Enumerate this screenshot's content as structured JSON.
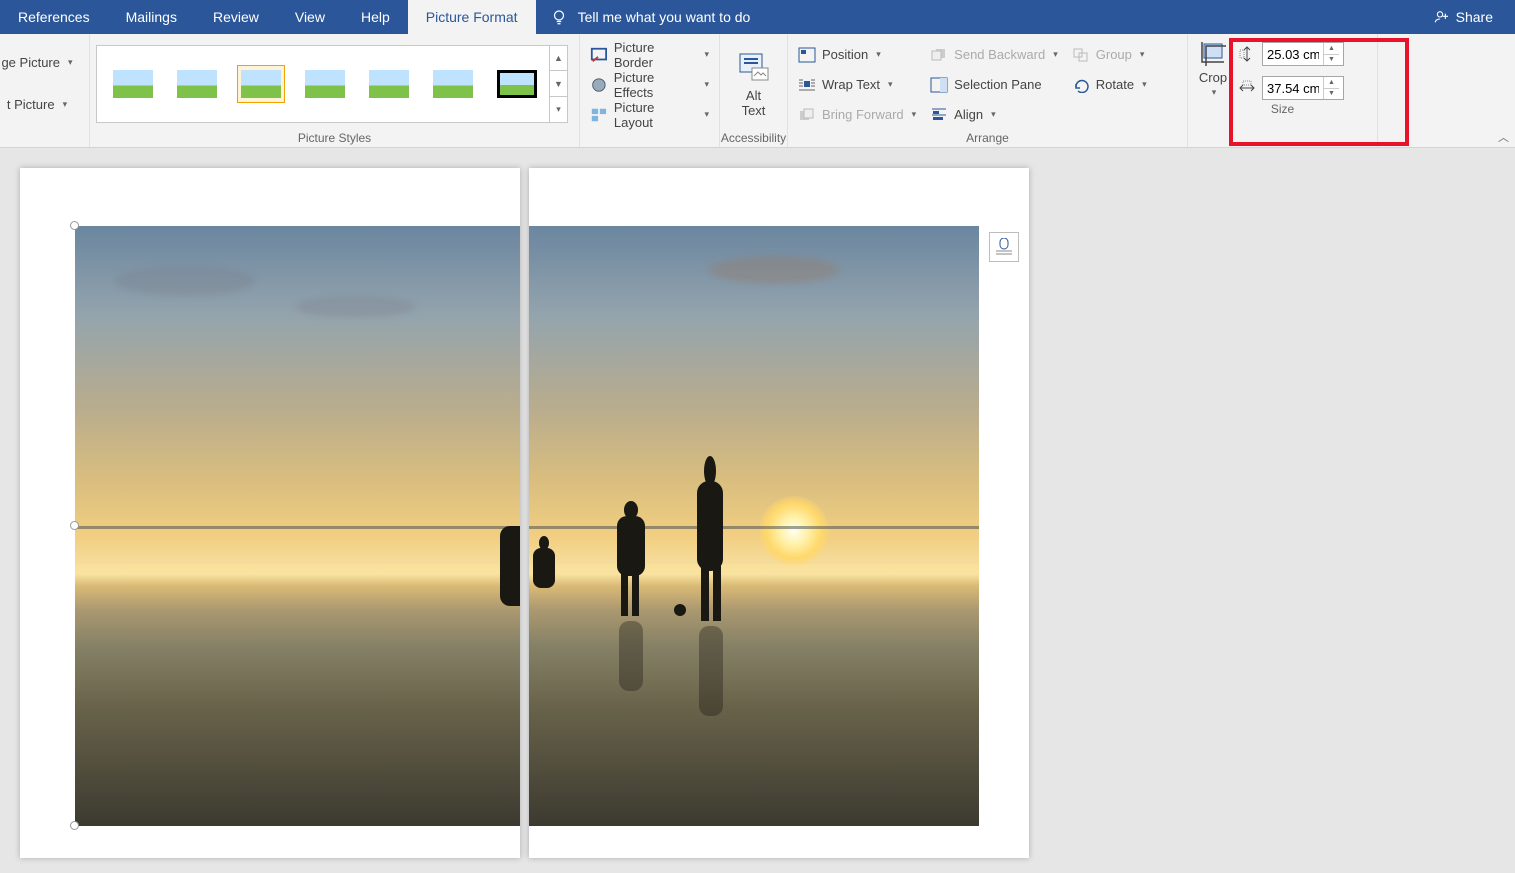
{
  "tabs": {
    "references": "References",
    "mailings": "Mailings",
    "review": "Review",
    "view": "View",
    "help": "Help",
    "picture_format": "Picture Format"
  },
  "tellme": {
    "placeholder": "Tell me what you want to do"
  },
  "share": {
    "label": "Share"
  },
  "left": {
    "change_picture": "ge Picture",
    "reset_picture": "t Picture"
  },
  "styles": {
    "label": "Picture Styles"
  },
  "piccmds": {
    "border": "Picture Border",
    "effects": "Picture Effects",
    "layout": "Picture Layout"
  },
  "alttext": {
    "line1": "Alt",
    "line2": "Text",
    "group": "Accessibility"
  },
  "arrange": {
    "position": "Position",
    "wrap": "Wrap Text",
    "forward": "Bring Forward",
    "backward": "Send Backward",
    "selpane": "Selection Pane",
    "align": "Align",
    "group": "Group",
    "rotate": "Rotate",
    "label": "Arrange"
  },
  "size": {
    "crop": "Crop",
    "height": "25.03 cm",
    "width": "37.54 cm",
    "label": "Size"
  }
}
